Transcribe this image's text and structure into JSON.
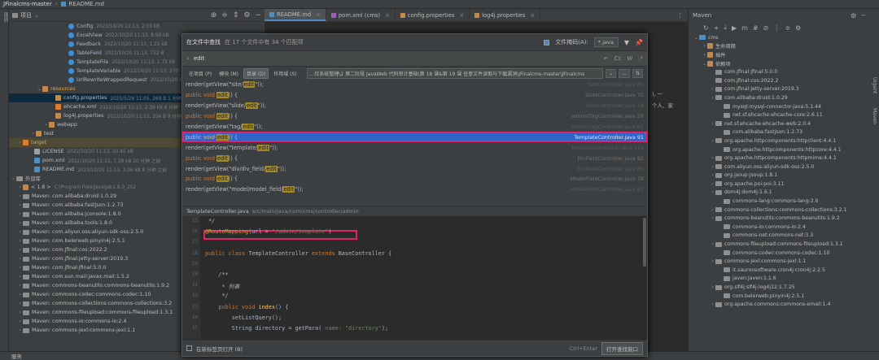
{
  "window": {
    "project": "JFinalcms-master",
    "file": "README.md"
  },
  "left_strip": "项目",
  "project_panel": {
    "title": "项目",
    "rows": [
      {
        "indent": 66,
        "icon": "c",
        "name": "Config",
        "meta": "2022/10/20 11:13, 2.03 kB"
      },
      {
        "indent": 66,
        "icon": "c",
        "name": "ExcelView",
        "meta": "2022/10/20 11:13, 8.98 kB"
      },
      {
        "indent": 66,
        "icon": "c",
        "name": "Feedback",
        "meta": "2022/10/20 11:13, 1.25 kB"
      },
      {
        "indent": 66,
        "icon": "c",
        "name": "TableField",
        "meta": "2022/10/20 11:13, 732 B"
      },
      {
        "indent": 66,
        "icon": "c",
        "name": "TemplateFile",
        "meta": "2022/10/20 11:13, 1.72 kB"
      },
      {
        "indent": 66,
        "icon": "c",
        "name": "TemplateVariable",
        "meta": "2022/10/20 11:13, 370"
      },
      {
        "indent": 66,
        "icon": "c",
        "name": "UrlRewriteWrappedRequest",
        "meta": "2022/10/20 11"
      },
      {
        "indent": 34,
        "arrow": "⌄",
        "icon": "f",
        "name": "resources",
        "meta": ""
      },
      {
        "indent": 50,
        "icon": "f",
        "name": "config.properties",
        "meta": "2025/5/26 11:05, 269 B 1 分钟",
        "sel": true
      },
      {
        "indent": 50,
        "icon": "x",
        "name": "ehcache.xml",
        "meta": "2022/10/20 11:13, 2.39 kB 8 分钟"
      },
      {
        "indent": 50,
        "icon": "f",
        "name": "log4j.properties",
        "meta": "2022/10/20 11:13, 256 B 8 分钟"
      },
      {
        "indent": 42,
        "arrow": "›",
        "icon": "f",
        "name": "webapp",
        "meta": ""
      },
      {
        "indent": 26,
        "arrow": "›",
        "icon": "f",
        "name": "test",
        "meta": ""
      },
      {
        "indent": 10,
        "arrow": "›",
        "icon": "x",
        "name": "target",
        "meta": "",
        "tgt": true
      },
      {
        "indent": 24,
        "icon": "lic",
        "name": "LICENSE",
        "meta": "2022/10/20 11:13, 10.45 kB"
      },
      {
        "indent": 24,
        "icon": "md",
        "name": "pom.xml",
        "meta": "2022/10/20 11:13, 7.38 kB 10 分钟 之前"
      },
      {
        "indent": 24,
        "icon": "md",
        "name": "README.md",
        "meta": "2022/10/20 11:13, 3.06 kB 8 分钟 之前"
      },
      {
        "indent": 2,
        "arrow": "⌄",
        "icon": "lib",
        "name": "外部库",
        "meta": ""
      },
      {
        "indent": 10,
        "arrow": "›",
        "icon": "f",
        "name": "< 1.8 >",
        "meta": "C:\\Program Files\\Java\\jdk1.8.0_202"
      },
      {
        "indent": 10,
        "arrow": "›",
        "icon": "lib",
        "name": "Maven: com.alibaba:druid:1.0.29",
        "meta": ""
      },
      {
        "indent": 10,
        "arrow": "›",
        "icon": "lib",
        "name": "Maven: com.alibaba:fastjson:1.2.73",
        "meta": ""
      },
      {
        "indent": 10,
        "arrow": "›",
        "icon": "lib",
        "name": "Maven: com.alibaba:jconsole:1.8.0",
        "meta": ""
      },
      {
        "indent": 10,
        "arrow": "›",
        "icon": "lib",
        "name": "Maven: com.alibaba:tools:1.8.0",
        "meta": ""
      },
      {
        "indent": 10,
        "arrow": "›",
        "icon": "lib",
        "name": "Maven: com.aliyun.oss:aliyun-sdk-oss:2.5.0",
        "meta": ""
      },
      {
        "indent": 10,
        "arrow": "›",
        "icon": "lib",
        "name": "Maven: com.belerweb:pinyin4j:2.5.1",
        "meta": ""
      },
      {
        "indent": 10,
        "arrow": "›",
        "icon": "lib",
        "name": "Maven: com.jfinal:cos:2022.2",
        "meta": ""
      },
      {
        "indent": 10,
        "arrow": "›",
        "icon": "lib",
        "name": "Maven: com.jfinal:jetty-server:2019.3",
        "meta": ""
      },
      {
        "indent": 10,
        "arrow": "›",
        "icon": "lib",
        "name": "Maven: com.jfinal:jfinal:5.0.0",
        "meta": ""
      },
      {
        "indent": 10,
        "arrow": "›",
        "icon": "lib",
        "name": "Maven: com.sun.mail:javax.mail:1.5.2",
        "meta": ""
      },
      {
        "indent": 10,
        "arrow": "›",
        "icon": "lib",
        "name": "Maven: commons-beanutils:commons-beanutils:1.9.2",
        "meta": ""
      },
      {
        "indent": 10,
        "arrow": "›",
        "icon": "lib",
        "name": "Maven: commons-codec:commons-codec:1.10",
        "meta": ""
      },
      {
        "indent": 10,
        "arrow": "›",
        "icon": "lib",
        "name": "Maven: commons-collections:commons-collections:3.2",
        "meta": ""
      },
      {
        "indent": 10,
        "arrow": "›",
        "icon": "lib",
        "name": "Maven: commons-fileupload:commons-fileupload:1.3.1",
        "meta": ""
      },
      {
        "indent": 10,
        "arrow": "›",
        "icon": "lib",
        "name": "Maven: commons-io:commons-io:2.4",
        "meta": ""
      },
      {
        "indent": 10,
        "arrow": "›",
        "icon": "lib",
        "name": "Maven: commons-jexl:commons-jexl:1.1",
        "meta": ""
      }
    ]
  },
  "tabs": [
    {
      "label": "README.md",
      "active": true
    },
    {
      "label": "pom.xml (cms)",
      "active": false
    },
    {
      "label": "config.properties",
      "active": false
    },
    {
      "label": "log4j.properties",
      "active": false
    }
  ],
  "editor_bg": {
    "line1": "), 一",
    "line2": "个人、家"
  },
  "find": {
    "title": "在文件中查找",
    "count": "在 17 个文件中有 34 个匹配项",
    "file_mask_label": "文件掩码(A):",
    "file_mask_value": "*.java",
    "query": "edit",
    "opt_cc": "Cc",
    "opt_w": "W",
    "opt_regex": ".*",
    "scope_buttons": [
      "在项目 (P)",
      "模块 (M)",
      "目录 (D)",
      "作用域 (S)"
    ],
    "scope_path": "...仅系统整理\\2 第二阶段 JavaWeb 代码审计基础\\第 18 课&第 19 课 任意文件读取与下载漏洞\\JFinalcms-master\\JFinalcms",
    "more": "...",
    "results": [
      {
        "pre": "render(getView(\"site/",
        "hit": "edit",
        "post": "\"));",
        "file": "SiteController.java 80",
        "dim": true
      },
      {
        "pre": "public void ",
        "hit": "edit",
        "post": "() {",
        "file": "SlideController.java 70",
        "kw": true
      },
      {
        "pre": "render(getView(\"slide/",
        "hit": "edit",
        "post": "\"));",
        "file": "SlideController.java 74",
        "dim": true
      },
      {
        "pre": "public void ",
        "hit": "edit",
        "post": "() {",
        "file": "admin\\TagController.java 59",
        "kw": true
      },
      {
        "pre": "render(getView(\"tag/",
        "hit": "edit",
        "post": "\"));",
        "file": "admin\\TagController.java 62",
        "dim": true
      },
      {
        "pre": "public void ",
        "hit": "edit",
        "post": "() {",
        "file": "TemplateController.java 91",
        "kw": true,
        "sel": true
      },
      {
        "pre": "render(getView(\"template/",
        "hit": "edit",
        "post": "\"));",
        "file": "TemplateController.java 114",
        "dim": true
      },
      {
        "pre": "public void ",
        "hit": "edit",
        "post": "() {",
        "file": "DivFieldController.java 82",
        "kw": true
      },
      {
        "pre": "render(getView(\"div/div_field/",
        "hit": "edit",
        "post": "\"));",
        "file": "DivFieldController.java 85",
        "dim": true
      },
      {
        "pre": "public void ",
        "hit": "edit",
        "post": "() {",
        "file": "ModelFieldController.java 78",
        "kw": true
      },
      {
        "pre": "render(getView(\"model/model_field/",
        "hit": "edit",
        "post": "\"));",
        "file": "ModelFieldController.java 81",
        "dim": true
      }
    ],
    "preview_file": "TemplateController.java",
    "preview_path": "src/main/java/com/cms/controller/admin",
    "preview_lines": [
      {
        "n": "25",
        "code": " */",
        "cls": "com"
      },
      {
        "n": "26",
        "code": "@RouteMapping(url = \"/admin/template\")",
        "cls": "anno"
      },
      {
        "n": "27",
        "code": "",
        "cls": ""
      },
      {
        "n": "28",
        "code": "public class TemplateController extends BaseController {",
        "cls": "cls"
      },
      {
        "n": "29",
        "code": "",
        "cls": ""
      },
      {
        "n": "30",
        "code": "    /**",
        "cls": "com"
      },
      {
        "n": "31",
        "code": "     * 列表",
        "cls": "com"
      },
      {
        "n": "32",
        "code": "     */",
        "cls": "com"
      },
      {
        "n": "33",
        "code": "    public void index() {",
        "cls": "m"
      },
      {
        "n": "34",
        "code": "        setListQuery();",
        "cls": ""
      },
      {
        "n": "35",
        "code": "        String directory = getPara( name: \"directory\");",
        "cls": "dir"
      }
    ],
    "new_tab_label": "在新标签页打开 (B)",
    "shortcut": "Ctrl+Enter",
    "open_button": "打开查找窗口"
  },
  "maven": {
    "title": "Maven",
    "rows": [
      {
        "indent": 6,
        "arrow": "⌄",
        "name": "cms"
      },
      {
        "indent": 16,
        "arrow": "›",
        "name": "生命周期"
      },
      {
        "indent": 16,
        "arrow": "›",
        "name": "插件"
      },
      {
        "indent": 16,
        "arrow": "⌄",
        "name": "依赖项"
      },
      {
        "indent": 26,
        "arrow": "",
        "name": "com.jfinal:jfinal:5.0.0"
      },
      {
        "indent": 26,
        "arrow": "",
        "name": "com.jfinal:cos:2022.2"
      },
      {
        "indent": 26,
        "arrow": "›",
        "name": "com.jfinal:jetty-server:2019.3"
      },
      {
        "indent": 26,
        "arrow": "›",
        "name": "com.alibaba:druid:1.0.29"
      },
      {
        "indent": 36,
        "arrow": "",
        "name": "mysql:mysql-connector-java:5.1.44"
      },
      {
        "indent": 36,
        "arrow": "",
        "name": "net.sf.ehcache:ehcache-core:2.6.11"
      },
      {
        "indent": 26,
        "arrow": "›",
        "name": "net.sf.ehcache:ehcache-web:2.0.4"
      },
      {
        "indent": 36,
        "arrow": "",
        "name": "com.alibaba:fastjson:1.2.73"
      },
      {
        "indent": 26,
        "arrow": "›",
        "name": "org.apache.httpcomponents:httpclient:4.4.1"
      },
      {
        "indent": 36,
        "arrow": "",
        "name": "org.apache.httpcomponents:httpcore:4.4.1"
      },
      {
        "indent": 26,
        "arrow": "›",
        "name": "org.apache.httpcomponents:httpmime:4.4.1"
      },
      {
        "indent": 26,
        "arrow": "›",
        "name": "com.aliyun.oss:aliyun-sdk-oss:2.5.0"
      },
      {
        "indent": 26,
        "arrow": "›",
        "name": "org.jsoup:jsoup:1.8.1"
      },
      {
        "indent": 26,
        "arrow": "›",
        "name": "org.apache.poi:poi:3.11"
      },
      {
        "indent": 26,
        "arrow": "›",
        "name": "dom4j:dom4j:1.6.1"
      },
      {
        "indent": 36,
        "arrow": "",
        "name": "commons-lang:commons-lang:2.6"
      },
      {
        "indent": 26,
        "arrow": "›",
        "name": "commons-collections:commons-collections:3.2.1"
      },
      {
        "indent": 26,
        "arrow": "›",
        "name": "commons-beanutils:commons-beanutils:1.9.2"
      },
      {
        "indent": 36,
        "arrow": "",
        "name": "commons-io:commons-io:2.4"
      },
      {
        "indent": 36,
        "arrow": "",
        "name": "commons-net:commons-net:3.3"
      },
      {
        "indent": 26,
        "arrow": "›",
        "name": "commons-fileupload:commons-fileupload:1.3.1"
      },
      {
        "indent": 36,
        "arrow": "",
        "name": "commons-codec:commons-codec:1.10"
      },
      {
        "indent": 26,
        "arrow": "›",
        "name": "commons-jexl:commons-jexl:1.1"
      },
      {
        "indent": 36,
        "arrow": "",
        "name": "it.sauronsoftware.cron4j:cron4j:2.2.5"
      },
      {
        "indent": 36,
        "arrow": "",
        "name": "javen:javen:1.1.6"
      },
      {
        "indent": 26,
        "arrow": "›",
        "name": "org.slf4j:slf4j-log4j12:1.7.25"
      },
      {
        "indent": 36,
        "arrow": "",
        "name": "com.belerweb:pinyin4j:2.5.1"
      },
      {
        "indent": 26,
        "arrow": "›",
        "name": "org.apache.commons:commons-email:1.4"
      }
    ]
  },
  "right_strip": [
    "Maven",
    "Urgent"
  ],
  "bottom": {
    "label": "服务"
  }
}
